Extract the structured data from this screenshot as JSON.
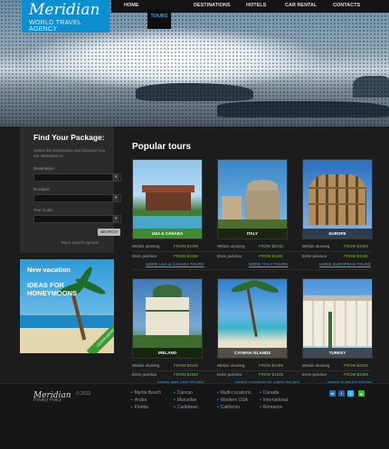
{
  "logo": {
    "name": "Meridian",
    "tagline": "WORLD TRAVEL AGENCY"
  },
  "nav": {
    "items": [
      "HOME",
      "DESTINATIONS",
      "HOTELS",
      "CAR RENTAL",
      "CONTACTS"
    ],
    "active": "TOURS"
  },
  "sidebar": {
    "title": "Find Your Package:",
    "description": "Select the Destination and Duration you are interested in.",
    "destination_label": "Destination:",
    "duration_label": "Duration:",
    "tour_code_label": "Tour Code:",
    "search_button": "SEARCH",
    "more_search": "More search options"
  },
  "promo": {
    "line1": "New vacation",
    "line2": "IDEAS FOR HONEYMOONS",
    "ribbon": "LEARN MORE"
  },
  "tours": {
    "title": "Popular tours",
    "cards": [
      {
        "name": "USA & CANADA",
        "row1": "Weluis ulusneg",
        "price1": "FROM $1099",
        "row2": "Enim pulvinar",
        "price2": "FROM $1199",
        "more": "MORE USA & CANADA TOURS"
      },
      {
        "name": "ITALY",
        "row1": "Weluis ulusneg",
        "price1": "FROM $2030",
        "row2": "Enim pulvinar",
        "price2": "FROM $1155",
        "more": "MORE ITALY TOURS"
      },
      {
        "name": "EUROPE",
        "row1": "Weluis ulusneg",
        "price1": "FROM $1058",
        "row2": "Enim pulvinar",
        "price2": "FROM $1155",
        "more": "MORE EUROPEAN TOURS"
      },
      {
        "name": "IRELAND",
        "row1": "Weluis ulusneg",
        "price1": "FROM $2020",
        "row2": "Enim pulvinar",
        "price2": "FROM $1550",
        "more": "MORE IRELAND TOURS"
      },
      {
        "name": "CAYMAN ISLANDS",
        "row1": "Weluis ulusneg",
        "price1": "FROM $1099",
        "row2": "Enim pulvinar",
        "price2": "FROM $1235",
        "more": "MORE CAYMAN ISLANDS TOURS"
      },
      {
        "name": "TURKEY",
        "row1": "Weluis ulusneg",
        "price1": "FROM $2020",
        "row2": "Enim pulvinar",
        "price2": "FROM $1099",
        "more": "MORE TURKEY TOURS"
      }
    ]
  },
  "footer": {
    "logo": "Meridian",
    "copyright": "© 2012",
    "privacy": "Privacy Policy",
    "col1": [
      "Myrtle Beach",
      "Aruba",
      "Florida"
    ],
    "col2": [
      "Cancun",
      "Marcellan",
      "Caribbean"
    ],
    "col3": [
      "Multi-Locations",
      "Western USA",
      "California"
    ],
    "col4": [
      "Canada",
      "International",
      "Romance"
    ],
    "social": [
      "in",
      "f",
      "t",
      "g"
    ]
  },
  "colors": {
    "accent": "#2fa3e6",
    "price": "#7fb842",
    "logo_bg": "#0b8fd1"
  }
}
